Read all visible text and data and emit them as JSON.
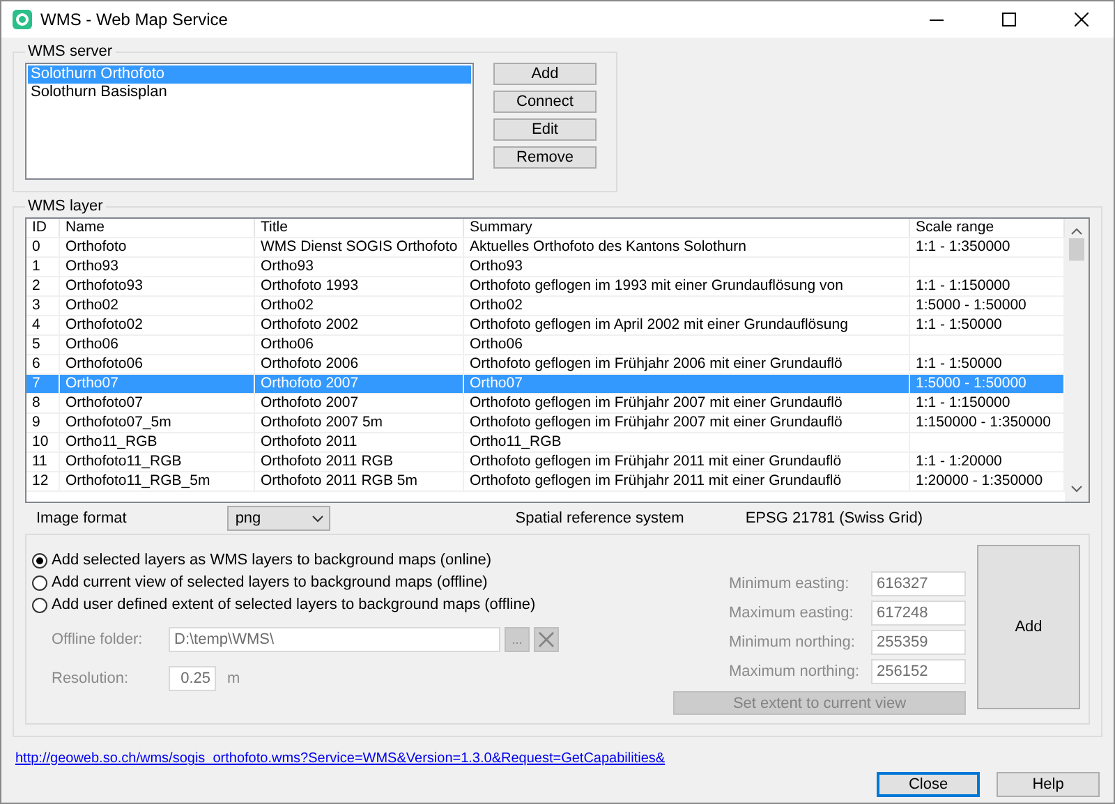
{
  "window": {
    "title": "WMS - Web Map Service"
  },
  "wms_server": {
    "label": "WMS server",
    "servers": [
      {
        "name": "Solothurn Orthofoto",
        "selected": true
      },
      {
        "name": "Solothurn Basisplan",
        "selected": false
      }
    ],
    "buttons": [
      "Add",
      "Connect",
      "Edit",
      "Remove"
    ]
  },
  "wms_layer": {
    "label": "WMS layer",
    "columns": [
      "ID",
      "Name",
      "Title",
      "Summary",
      "Scale range"
    ],
    "rows": [
      {
        "cells": [
          "0",
          "Orthofoto",
          "WMS Dienst SOGIS Orthofoto",
          "Aktuelles Orthofoto des Kantons Solothurn",
          "1:1 - 1:350000"
        ],
        "selected": false
      },
      {
        "cells": [
          "1",
          "Ortho93",
          "Ortho93",
          "Ortho93",
          ""
        ],
        "selected": false
      },
      {
        "cells": [
          "2",
          "Orthofoto93",
          "Orthofoto 1993",
          "Orthofoto geflogen im 1993 mit einer Grundauflösung von",
          "1:1 - 1:150000"
        ],
        "selected": false
      },
      {
        "cells": [
          "3",
          "Ortho02",
          "Ortho02",
          "Ortho02",
          "1:5000 - 1:50000"
        ],
        "selected": false
      },
      {
        "cells": [
          "4",
          "Orthofoto02",
          "Orthofoto 2002",
          "Orthofoto geflogen im April 2002 mit einer Grundauflösung",
          "1:1 - 1:50000"
        ],
        "selected": false
      },
      {
        "cells": [
          "5",
          "Ortho06",
          "Ortho06",
          "Ortho06",
          ""
        ],
        "selected": false
      },
      {
        "cells": [
          "6",
          "Orthofoto06",
          "Orthofoto 2006",
          "Orthofoto geflogen im Frühjahr 2006 mit einer Grundauflö",
          "1:1 - 1:50000"
        ],
        "selected": false
      },
      {
        "cells": [
          "7",
          "Ortho07",
          "Orthofoto 2007",
          "Ortho07",
          "1:5000 - 1:50000"
        ],
        "selected": true
      },
      {
        "cells": [
          "8",
          "Orthofoto07",
          "Orthofoto 2007",
          "Orthofoto geflogen im Frühjahr 2007 mit einer Grundauflö",
          "1:1 - 1:150000"
        ],
        "selected": false
      },
      {
        "cells": [
          "9",
          "Orthofoto07_5m",
          "Orthofoto 2007 5m",
          "Orthofoto geflogen im Frühjahr 2007 mit einer Grundauflö",
          "1:150000 - 1:350000"
        ],
        "selected": false
      },
      {
        "cells": [
          "10",
          "Ortho11_RGB",
          "Orthofoto 2011",
          "Ortho11_RGB",
          ""
        ],
        "selected": false
      },
      {
        "cells": [
          "11",
          "Orthofoto11_RGB",
          "Orthofoto 2011 RGB",
          "Orthofoto geflogen im Frühjahr 2011 mit einer Grundauflö",
          "1:1 - 1:20000"
        ],
        "selected": false
      },
      {
        "cells": [
          "12",
          "Orthofoto11_RGB_5m",
          "Orthofoto 2011 RGB 5m",
          "Orthofoto geflogen im Frühjahr 2011 mit einer Grundauflö",
          "1:20000 - 1:350000"
        ],
        "selected": false
      }
    ]
  },
  "image_format": {
    "label": "Image format",
    "value": "png"
  },
  "spatial_reference": {
    "label": "Spatial reference system",
    "value": "EPSG 21781 (Swiss Grid)"
  },
  "options": [
    {
      "label": "Add selected layers as WMS layers to background maps (online)",
      "selected": true
    },
    {
      "label": "Add current view of selected layers to background maps (offline)",
      "selected": false
    },
    {
      "label": "Add user defined extent of selected layers to background maps (offline)",
      "selected": false
    }
  ],
  "offline_folder": {
    "label": "Offline folder:",
    "value": "D:\\temp\\WMS\\",
    "browse": "...",
    "disabled": true
  },
  "resolution": {
    "label": "Resolution:",
    "value": "0.25",
    "unit": "m",
    "disabled": true
  },
  "extent": {
    "disabled": true,
    "fields": [
      {
        "label": "Minimum easting:",
        "value": "616327"
      },
      {
        "label": "Maximum easting:",
        "value": "617248"
      },
      {
        "label": "Minimum northing:",
        "value": "255359"
      },
      {
        "label": "Maximum northing:",
        "value": "256152"
      }
    ],
    "button": "Set extent to current view"
  },
  "add_button": "Add",
  "link": "http://geoweb.so.ch/wms/sogis_orthofoto.wms?Service=WMS&Version=1.3.0&Request=GetCapabilities&",
  "footer_buttons": [
    {
      "label": "Close",
      "focused": true
    },
    {
      "label": "Help",
      "focused": false
    }
  ]
}
